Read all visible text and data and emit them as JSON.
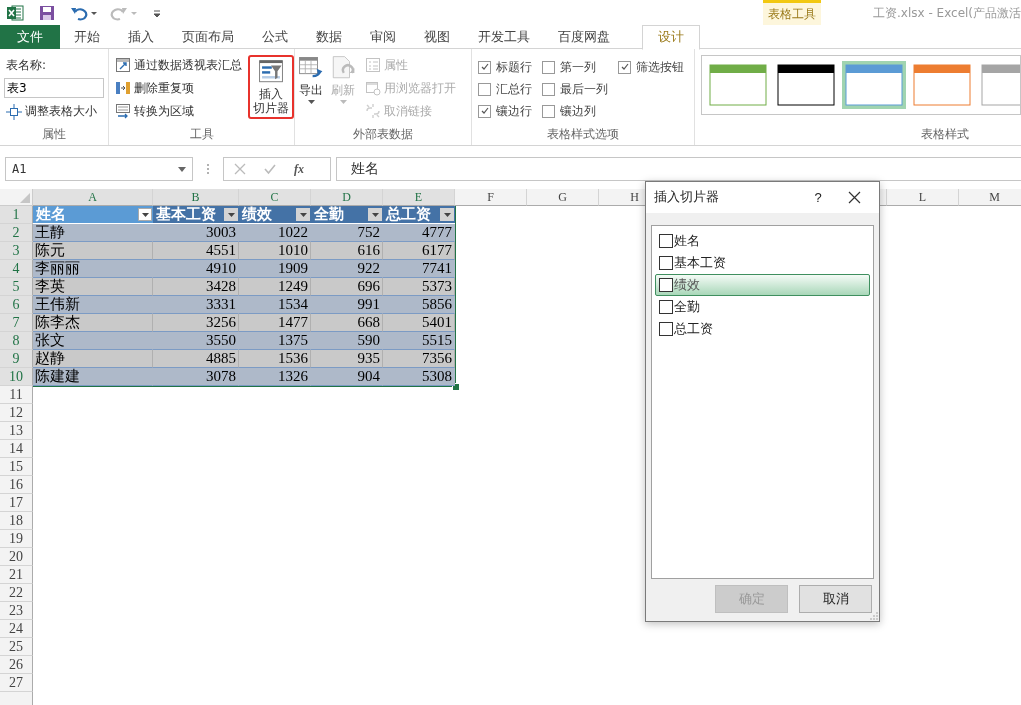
{
  "title_bar": {
    "context_group": "表格工具",
    "title": "工资.xlsx - Excel(产品激活"
  },
  "tabs": [
    {
      "label": "文件",
      "kind": "file",
      "selected": false
    },
    {
      "label": "开始",
      "kind": "normal",
      "selected": false
    },
    {
      "label": "插入",
      "kind": "normal",
      "selected": false
    },
    {
      "label": "页面布局",
      "kind": "normal",
      "selected": false
    },
    {
      "label": "公式",
      "kind": "normal",
      "selected": false
    },
    {
      "label": "数据",
      "kind": "normal",
      "selected": false
    },
    {
      "label": "审阅",
      "kind": "normal",
      "selected": false
    },
    {
      "label": "视图",
      "kind": "normal",
      "selected": false
    },
    {
      "label": "开发工具",
      "kind": "normal",
      "selected": false
    },
    {
      "label": "百度网盘",
      "kind": "normal",
      "selected": false
    },
    {
      "label": "设计",
      "kind": "context",
      "selected": true
    }
  ],
  "ribbon": {
    "properties": {
      "label": "属性",
      "table_name_label": "表名称:",
      "table_name": "表3",
      "resize_button": "调整表格大小"
    },
    "tools": {
      "label": "工具",
      "items": [
        {
          "label": "通过数据透视表汇总"
        },
        {
          "label": "删除重复项"
        },
        {
          "label": "转换为区域"
        }
      ],
      "slicer_button": {
        "lines": [
          "插入",
          "切片器"
        ],
        "highlighted": true
      }
    },
    "external": {
      "label": "外部表数据",
      "export": {
        "label": "导出",
        "disabled": false
      },
      "refresh": {
        "label": "刷新",
        "disabled": true
      },
      "items": [
        {
          "label": "属性",
          "disabled": true
        },
        {
          "label": "用浏览器打开",
          "disabled": true
        },
        {
          "label": "取消链接",
          "disabled": true
        }
      ]
    },
    "style_options": {
      "label": "表格样式选项",
      "options": [
        {
          "label": "标题行",
          "checked": true
        },
        {
          "label": "汇总行",
          "checked": false
        },
        {
          "label": "镶边行",
          "checked": true
        },
        {
          "label": "第一列",
          "checked": false
        },
        {
          "label": "最后一列",
          "checked": false
        },
        {
          "label": "镶边列",
          "checked": false
        },
        {
          "label": "筛选按钮",
          "checked": true
        }
      ]
    },
    "styles": {
      "label": "表格样式",
      "swatches": [
        {
          "color": "#70ad47",
          "selected": false
        },
        {
          "color": "#000000",
          "selected": false
        },
        {
          "color": "#5b9bd5",
          "selected": true
        },
        {
          "color": "#ed7d31",
          "selected": false
        },
        {
          "color": "#a5a5a5",
          "selected": false
        }
      ]
    }
  },
  "formula_bar": {
    "name_box": "A1",
    "function_label": "fx",
    "content": "姓名"
  },
  "sheet": {
    "columns_left": [
      {
        "letter": "A",
        "highlighted": true
      },
      {
        "letter": "B",
        "highlighted": true
      },
      {
        "letter": "C",
        "highlighted": true
      },
      {
        "letter": "D",
        "highlighted": true
      },
      {
        "letter": "E",
        "highlighted": true
      },
      {
        "letter": "F",
        "highlighted": false
      },
      {
        "letter": "G",
        "highlighted": false
      },
      {
        "letter": "H",
        "highlighted": false
      }
    ],
    "columns_right": [
      {
        "letter": "L",
        "highlighted": false
      },
      {
        "letter": "M",
        "highlighted": false
      }
    ],
    "rows": [
      {
        "number": "1",
        "highlighted": true
      },
      {
        "number": "2",
        "highlighted": true
      },
      {
        "number": "3",
        "highlighted": true
      },
      {
        "number": "4",
        "highlighted": true
      },
      {
        "number": "5",
        "highlighted": true
      },
      {
        "number": "6",
        "highlighted": true
      },
      {
        "number": "7",
        "highlighted": true
      },
      {
        "number": "8",
        "highlighted": true
      },
      {
        "number": "9",
        "highlighted": true
      },
      {
        "number": "10",
        "highlighted": true
      },
      {
        "number": "11",
        "highlighted": false
      },
      {
        "number": "12",
        "highlighted": false
      },
      {
        "number": "13",
        "highlighted": false
      },
      {
        "number": "14",
        "highlighted": false
      },
      {
        "number": "15",
        "highlighted": false
      },
      {
        "number": "16",
        "highlighted": false
      },
      {
        "number": "17",
        "highlighted": false
      },
      {
        "number": "18",
        "highlighted": false
      },
      {
        "number": "19",
        "highlighted": false
      },
      {
        "number": "20",
        "highlighted": false
      },
      {
        "number": "21",
        "highlighted": false
      },
      {
        "number": "22",
        "highlighted": false
      },
      {
        "number": "23",
        "highlighted": false
      },
      {
        "number": "24",
        "highlighted": false
      },
      {
        "number": "25",
        "highlighted": false
      },
      {
        "number": "26",
        "highlighted": false
      },
      {
        "number": "27",
        "highlighted": false
      }
    ]
  },
  "table": {
    "columns": [
      {
        "label": "姓名",
        "selected": true
      },
      {
        "label": "基本工资",
        "selected": false
      },
      {
        "label": "绩效",
        "selected": false
      },
      {
        "label": "全勤",
        "selected": false
      },
      {
        "label": "总工资",
        "selected": false
      }
    ],
    "rows": [
      [
        "王静",
        "3003",
        "1022",
        "752",
        "4777"
      ],
      [
        "陈元",
        "4551",
        "1010",
        "616",
        "6177"
      ],
      [
        "李丽丽",
        "4910",
        "1909",
        "922",
        "7741"
      ],
      [
        "李英",
        "3428",
        "1249",
        "696",
        "5373"
      ],
      [
        "王伟新",
        "3331",
        "1534",
        "991",
        "5856"
      ],
      [
        "陈李杰",
        "3256",
        "1477",
        "668",
        "5401"
      ],
      [
        "张文",
        "3550",
        "1375",
        "590",
        "5515"
      ],
      [
        "赵静",
        "4885",
        "1536",
        "935",
        "7356"
      ],
      [
        "陈建建",
        "3078",
        "1326",
        "904",
        "5308"
      ]
    ]
  },
  "dialog": {
    "title": "插入切片器",
    "help": "?",
    "fields": [
      {
        "label": "姓名",
        "checked": false,
        "selected": false
      },
      {
        "label": "基本工资",
        "checked": false,
        "selected": false
      },
      {
        "label": "绩效",
        "checked": false,
        "selected": true
      },
      {
        "label": "全勤",
        "checked": false,
        "selected": false
      },
      {
        "label": "总工资",
        "checked": false,
        "selected": false
      }
    ],
    "buttons": [
      {
        "label": "确定",
        "disabled": true
      },
      {
        "label": "取消",
        "disabled": false
      }
    ]
  }
}
